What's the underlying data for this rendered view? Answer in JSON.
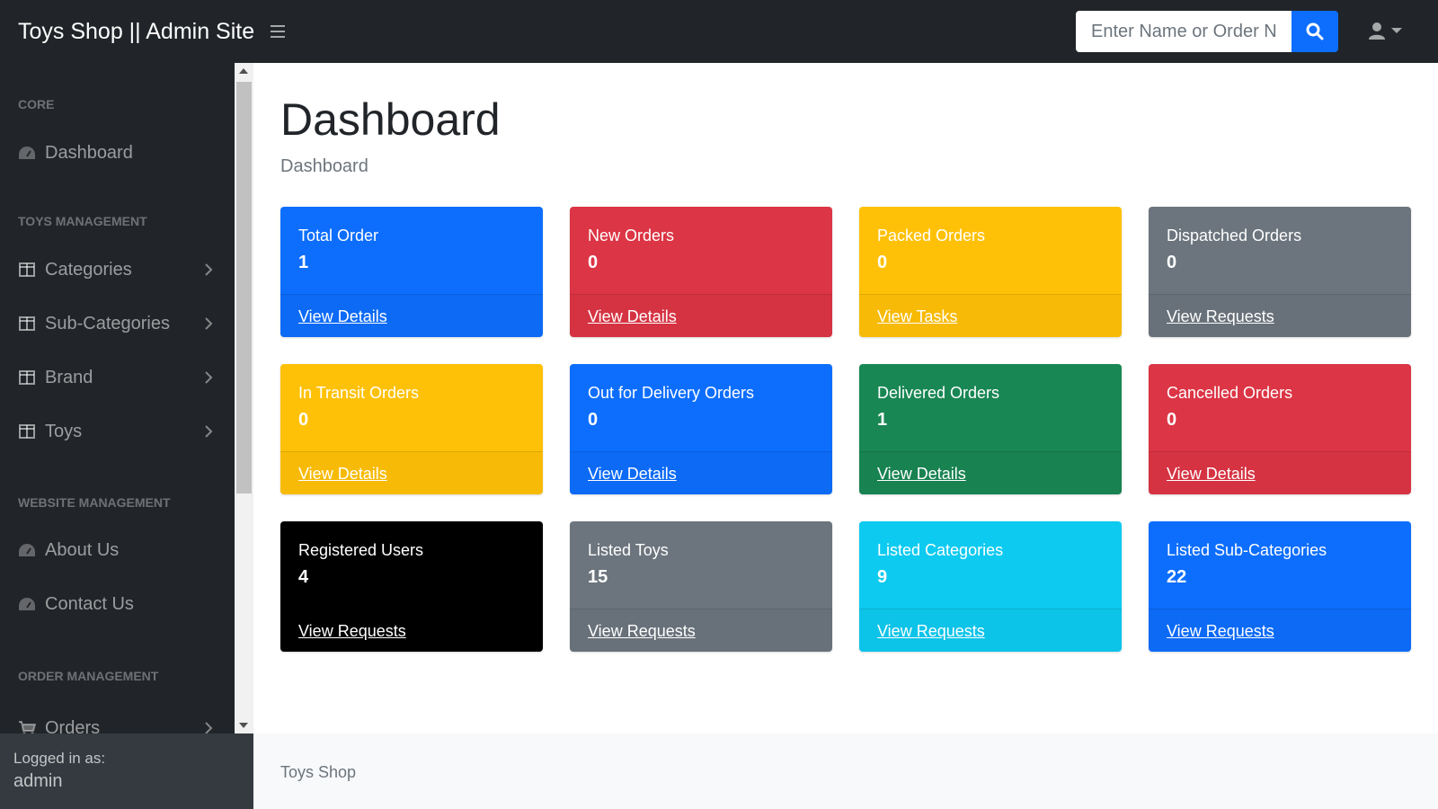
{
  "navbar": {
    "brand": "Toys Shop || Admin Site",
    "search_placeholder": "Enter Name or Order No"
  },
  "sidebar": {
    "sections": [
      {
        "heading": "CORE"
      },
      {
        "heading": "TOYS MANAGEMENT"
      },
      {
        "heading": "WEBSITE MANAGEMENT"
      },
      {
        "heading": "ORDER MANAGEMENT"
      }
    ],
    "items": [
      {
        "label": "Dashboard",
        "icon": "tachometer-icon"
      },
      {
        "label": "Categories",
        "icon": "columns-icon"
      },
      {
        "label": "Sub-Categories",
        "icon": "columns-icon"
      },
      {
        "label": "Brand",
        "icon": "columns-icon"
      },
      {
        "label": "Toys",
        "icon": "columns-icon"
      },
      {
        "label": "About Us",
        "icon": "tachometer-icon"
      },
      {
        "label": "Contact Us",
        "icon": "tachometer-icon"
      },
      {
        "label": "Orders",
        "icon": "cart-icon"
      }
    ],
    "footer": {
      "small": "Logged in as:",
      "user": "admin"
    }
  },
  "main": {
    "title": "Dashboard",
    "breadcrumb": "Dashboard",
    "cards": [
      {
        "label": "Total Order",
        "value": "1",
        "link": "View Details",
        "color": "#0d6efd"
      },
      {
        "label": "New Orders",
        "value": "0",
        "link": "View Details",
        "color": "#dc3545"
      },
      {
        "label": "Packed Orders",
        "value": "0",
        "link": "View Tasks",
        "color": "#ffc107"
      },
      {
        "label": "Dispatched Orders",
        "value": "0",
        "link": "View Requests",
        "color": "#6c757d"
      },
      {
        "label": "In Transit Orders",
        "value": "0",
        "link": "View Details",
        "color": "#ffc107"
      },
      {
        "label": "Out for Delivery Orders",
        "value": "0",
        "link": "View Details",
        "color": "#0d6efd"
      },
      {
        "label": "Delivered Orders",
        "value": "1",
        "link": "View Details",
        "color": "#198754"
      },
      {
        "label": "Cancelled Orders",
        "value": "0",
        "link": "View Details",
        "color": "#dc3545"
      },
      {
        "label": "Registered Users",
        "value": "4",
        "link": "View Requests",
        "color": "#000000"
      },
      {
        "label": "Listed Toys",
        "value": "15",
        "link": "View Requests",
        "color": "#6c757d"
      },
      {
        "label": "Listed Categories",
        "value": "9",
        "link": "View Requests",
        "color": "#0dcaf0"
      },
      {
        "label": "Listed Sub-Categories",
        "value": "22",
        "link": "View Requests",
        "color": "#0d6efd"
      }
    ]
  },
  "footer": {
    "text": "Toys Shop"
  }
}
